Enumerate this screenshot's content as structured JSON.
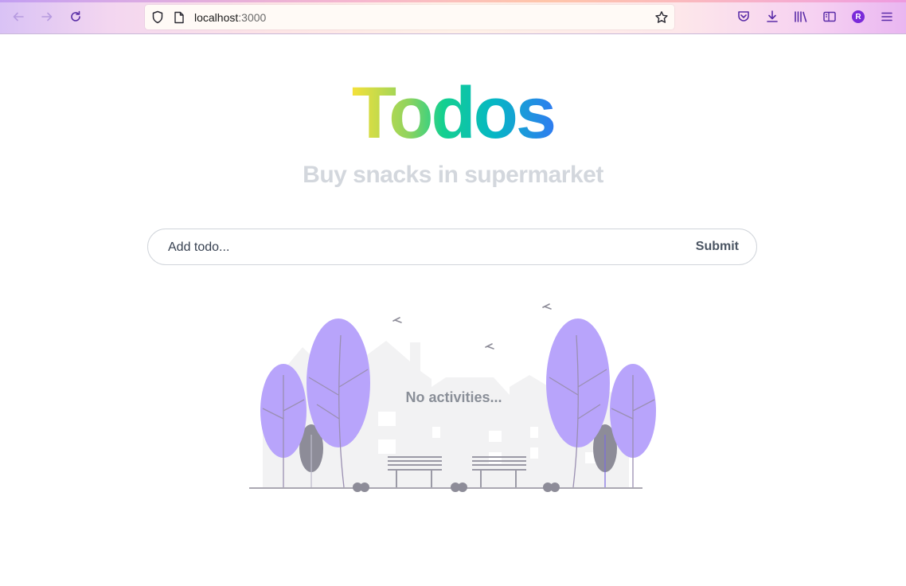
{
  "browser": {
    "url_host": "localhost",
    "url_port": ":3000",
    "profile_initial": "R"
  },
  "page": {
    "title": "Todos",
    "subtitle": "Buy snacks in supermarket",
    "form": {
      "placeholder": "Add todo...",
      "submit_label": "Submit"
    },
    "empty_state": "No activities..."
  }
}
